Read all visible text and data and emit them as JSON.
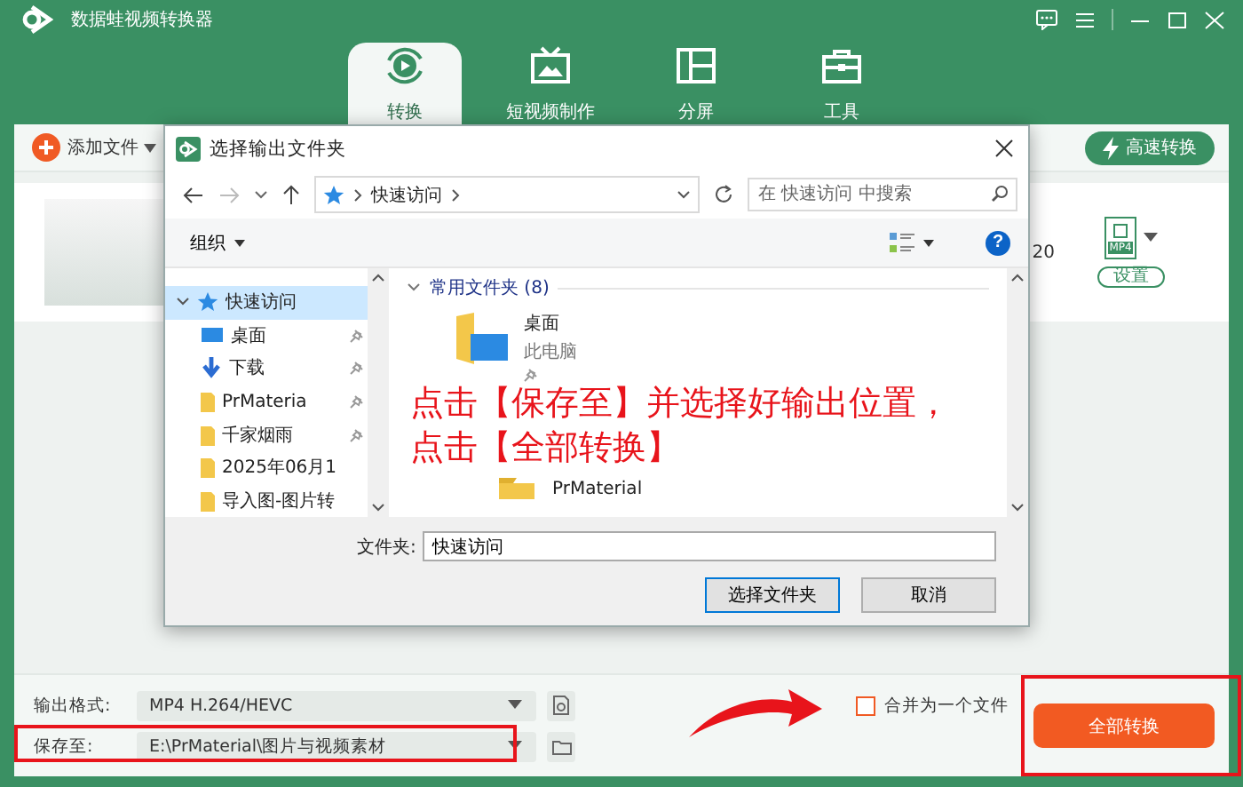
{
  "app": {
    "title": "数据蛙视频转换器"
  },
  "tabs": [
    {
      "label": "转换",
      "selected": true
    },
    {
      "label": "短视频制作",
      "selected": false
    },
    {
      "label": "分屏",
      "selected": false
    },
    {
      "label": "工具",
      "selected": false
    }
  ],
  "toolbar": {
    "add_file": "添加文件",
    "fast_convert": "高速转换"
  },
  "file_card": {
    "fragment": "20",
    "format_badge": "MP4",
    "settings_button": "设置"
  },
  "dialog": {
    "title": "选择输出文件夹",
    "breadcrumb": "快速访问",
    "search_placeholder": "在 快速访问 中搜索",
    "organize": "组织",
    "help_button": "?",
    "nav_tree": [
      {
        "label": "快速访问",
        "selected": true,
        "expanded": true,
        "children": [
          {
            "label": "桌面",
            "pinned": true,
            "selected": false
          },
          {
            "label": "下载",
            "pinned": true,
            "selected": false
          },
          {
            "label": "PrMateria",
            "pinned": true,
            "selected": false
          },
          {
            "label": "千家烟雨",
            "pinned": true,
            "selected": false
          },
          {
            "label": "2025年06月1",
            "pinned": false,
            "selected": false
          },
          {
            "label": "导入图-图片转",
            "pinned": false,
            "selected": false
          }
        ]
      }
    ],
    "section": {
      "label": "常用文件夹 (8)",
      "expanded": true
    },
    "folders": [
      {
        "name": "桌面",
        "location": "此电脑",
        "pinned": true
      },
      {
        "name": "PrMaterial"
      }
    ],
    "folder_field": {
      "label": "文件夹:",
      "value": "快速访问"
    },
    "buttons": [
      {
        "label": "选择文件夹",
        "default": true
      },
      {
        "label": "取消",
        "default": false
      }
    ]
  },
  "annotation": {
    "text": "点击【保存至】并选择好输出位置，点击【全部转换】"
  },
  "bottom": {
    "format_label": "输出格式:",
    "format_value": "MP4 H.264/HEVC",
    "save_label": "保存至:",
    "save_value": "E:\\PrMaterial\\图片与视频素材",
    "merge": {
      "label": "合并为一个文件",
      "checked": false
    },
    "convert_all": "全部转换"
  }
}
